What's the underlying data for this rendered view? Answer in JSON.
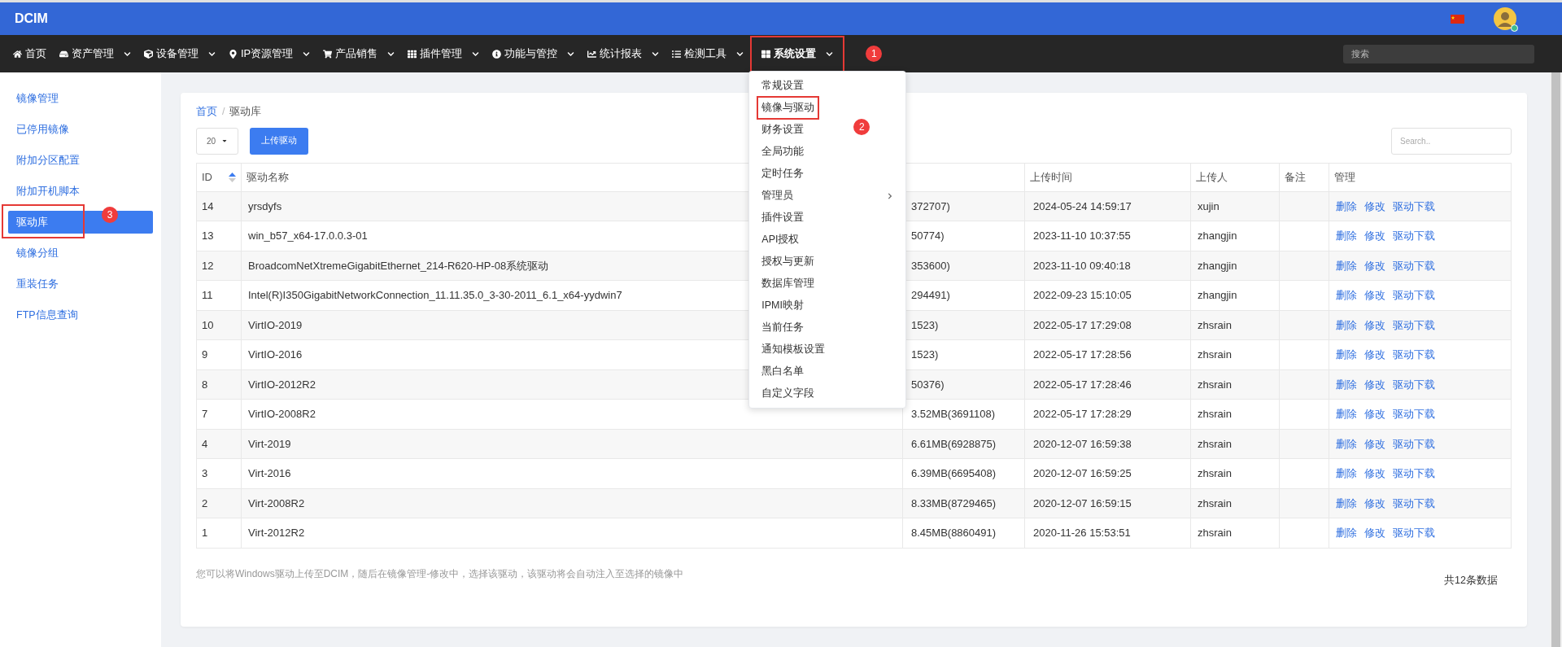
{
  "header": {
    "title": "DCIM",
    "user": {
      "online": true
    }
  },
  "nav": {
    "items": [
      {
        "label": "首页",
        "has_menu": false,
        "expanded": false
      },
      {
        "label": "资产管理",
        "has_menu": true,
        "expanded": false
      },
      {
        "label": "设备管理",
        "has_menu": true,
        "expanded": false
      },
      {
        "label": "IP资源管理",
        "has_menu": true,
        "expanded": false
      },
      {
        "label": "产品销售",
        "has_menu": true,
        "expanded": false
      },
      {
        "label": "插件管理",
        "has_menu": true,
        "expanded": false
      },
      {
        "label": "功能与管控",
        "has_menu": true,
        "expanded": false
      },
      {
        "label": "统计报表",
        "has_menu": true,
        "expanded": false
      },
      {
        "label": "检测工具",
        "has_menu": true,
        "expanded": false
      },
      {
        "label": "系统设置",
        "has_menu": true,
        "expanded": true,
        "marker": "1",
        "menu": [
          {
            "label": "常规设置",
            "has_submenu": false
          },
          {
            "label": "镜像与驱动",
            "has_submenu": false,
            "marker": "2"
          },
          {
            "label": "财务设置",
            "has_submenu": false
          },
          {
            "label": "全局功能",
            "has_submenu": false
          },
          {
            "label": "定时任务",
            "has_submenu": false
          },
          {
            "label": "管理员",
            "has_submenu": true
          },
          {
            "label": "插件设置",
            "has_submenu": false
          },
          {
            "label": "API授权",
            "has_submenu": false
          },
          {
            "label": "授权与更新",
            "has_submenu": false
          },
          {
            "label": "数据库管理",
            "has_submenu": false
          },
          {
            "label": "IPMI映射",
            "has_submenu": false
          },
          {
            "label": "当前任务",
            "has_submenu": false
          },
          {
            "label": "通知模板设置",
            "has_submenu": false
          },
          {
            "label": "黑白名单",
            "has_submenu": false
          },
          {
            "label": "自定义字段",
            "has_submenu": false
          }
        ]
      }
    ],
    "search": {
      "placeholder": "搜索"
    }
  },
  "sidebar": {
    "items": [
      {
        "label": "镜像管理",
        "selected": false
      },
      {
        "label": "已停用镜像",
        "selected": false
      },
      {
        "label": "附加分区配置",
        "selected": false
      },
      {
        "label": "附加开机脚本",
        "selected": false
      },
      {
        "label": "驱动库",
        "selected": true,
        "marker": "3"
      },
      {
        "label": "镜像分组",
        "selected": false
      },
      {
        "label": "重装任务",
        "selected": false
      },
      {
        "label": "FTP信息查询",
        "selected": false
      }
    ]
  },
  "breadcrumb": [
    "首页",
    "驱动库"
  ],
  "breadcrumb_separator": "/",
  "page_size": "20",
  "upload_button": "上传驱动",
  "table_search": {
    "placeholder": "Search.."
  },
  "table": {
    "columns": [
      {
        "label": "ID",
        "sorted_ascending": true
      },
      {
        "label": "驱动名称"
      },
      {},
      {
        "label": "上传时间"
      },
      {
        "label": "上传人"
      },
      {
        "label": "备注"
      },
      {
        "label": "管理"
      }
    ],
    "rows": [
      {
        "id": "14",
        "name": "yrsdyfs",
        "size": "372707)",
        "time": "2024-05-24 14:59:17",
        "uploader": "xujin",
        "actions": [
          "删除",
          "修改",
          "驱动下载"
        ]
      },
      {
        "id": "13",
        "name": "win_b57_x64-17.0.0.3-01",
        "size": "50774)",
        "time": "2023-11-10 10:37:55",
        "uploader": "zhangjin",
        "actions": [
          "删除",
          "修改",
          "驱动下载"
        ]
      },
      {
        "id": "12",
        "name": "BroadcomNetXtremeGigabitEthernet_214-R620-HP-08系统驱动",
        "size": "353600)",
        "time": "2023-11-10 09:40:18",
        "uploader": "zhangjin",
        "actions": [
          "删除",
          "修改",
          "驱动下载"
        ]
      },
      {
        "id": "11",
        "name": "Intel(R)I350GigabitNetworkConnection_11.11.35.0_3-30-2011_6.1_x64-yydwin7",
        "size": "294491)",
        "time": "2022-09-23 15:10:05",
        "uploader": "zhangjin",
        "actions": [
          "删除",
          "修改",
          "驱动下载"
        ]
      },
      {
        "id": "10",
        "name": "VirtIO-2019",
        "size": "1523)",
        "time": "2022-05-17 17:29:08",
        "uploader": "zhsrain",
        "actions": [
          "删除",
          "修改",
          "驱动下载"
        ]
      },
      {
        "id": "9",
        "name": "VirtIO-2016",
        "size": "1523)",
        "time": "2022-05-17 17:28:56",
        "uploader": "zhsrain",
        "actions": [
          "删除",
          "修改",
          "驱动下载"
        ]
      },
      {
        "id": "8",
        "name": "VirtIO-2012R2",
        "size": "50376)",
        "time": "2022-05-17 17:28:46",
        "uploader": "zhsrain",
        "actions": [
          "删除",
          "修改",
          "驱动下载"
        ]
      },
      {
        "id": "7",
        "name": "VirtIO-2008R2",
        "size": "3.52MB(3691108)",
        "time": "2022-05-17 17:28:29",
        "uploader": "zhsrain",
        "actions": [
          "删除",
          "修改",
          "驱动下载"
        ]
      },
      {
        "id": "4",
        "name": "Virt-2019",
        "size": "6.61MB(6928875)",
        "time": "2020-12-07 16:59:38",
        "uploader": "zhsrain",
        "actions": [
          "删除",
          "修改",
          "驱动下载"
        ]
      },
      {
        "id": "3",
        "name": "Virt-2016",
        "size": "6.39MB(6695408)",
        "time": "2020-12-07 16:59:25",
        "uploader": "zhsrain",
        "actions": [
          "删除",
          "修改",
          "驱动下载"
        ]
      },
      {
        "id": "2",
        "name": "Virt-2008R2",
        "size": "8.33MB(8729465)",
        "time": "2020-12-07 16:59:15",
        "uploader": "zhsrain",
        "actions": [
          "删除",
          "修改",
          "驱动下载"
        ]
      },
      {
        "id": "1",
        "name": "Virt-2012R2",
        "size": "8.45MB(8860491)",
        "time": "2020-11-26 15:53:51",
        "uploader": "zhsrain",
        "actions": [
          "删除",
          "修改",
          "驱动下载"
        ]
      }
    ]
  },
  "note": "您可以将Windows驱动上传至DCIM，随后在镜像管理-修改中，选择该驱动，该驱动将会自动注入至选择的镜像中",
  "total": "共12条数据"
}
